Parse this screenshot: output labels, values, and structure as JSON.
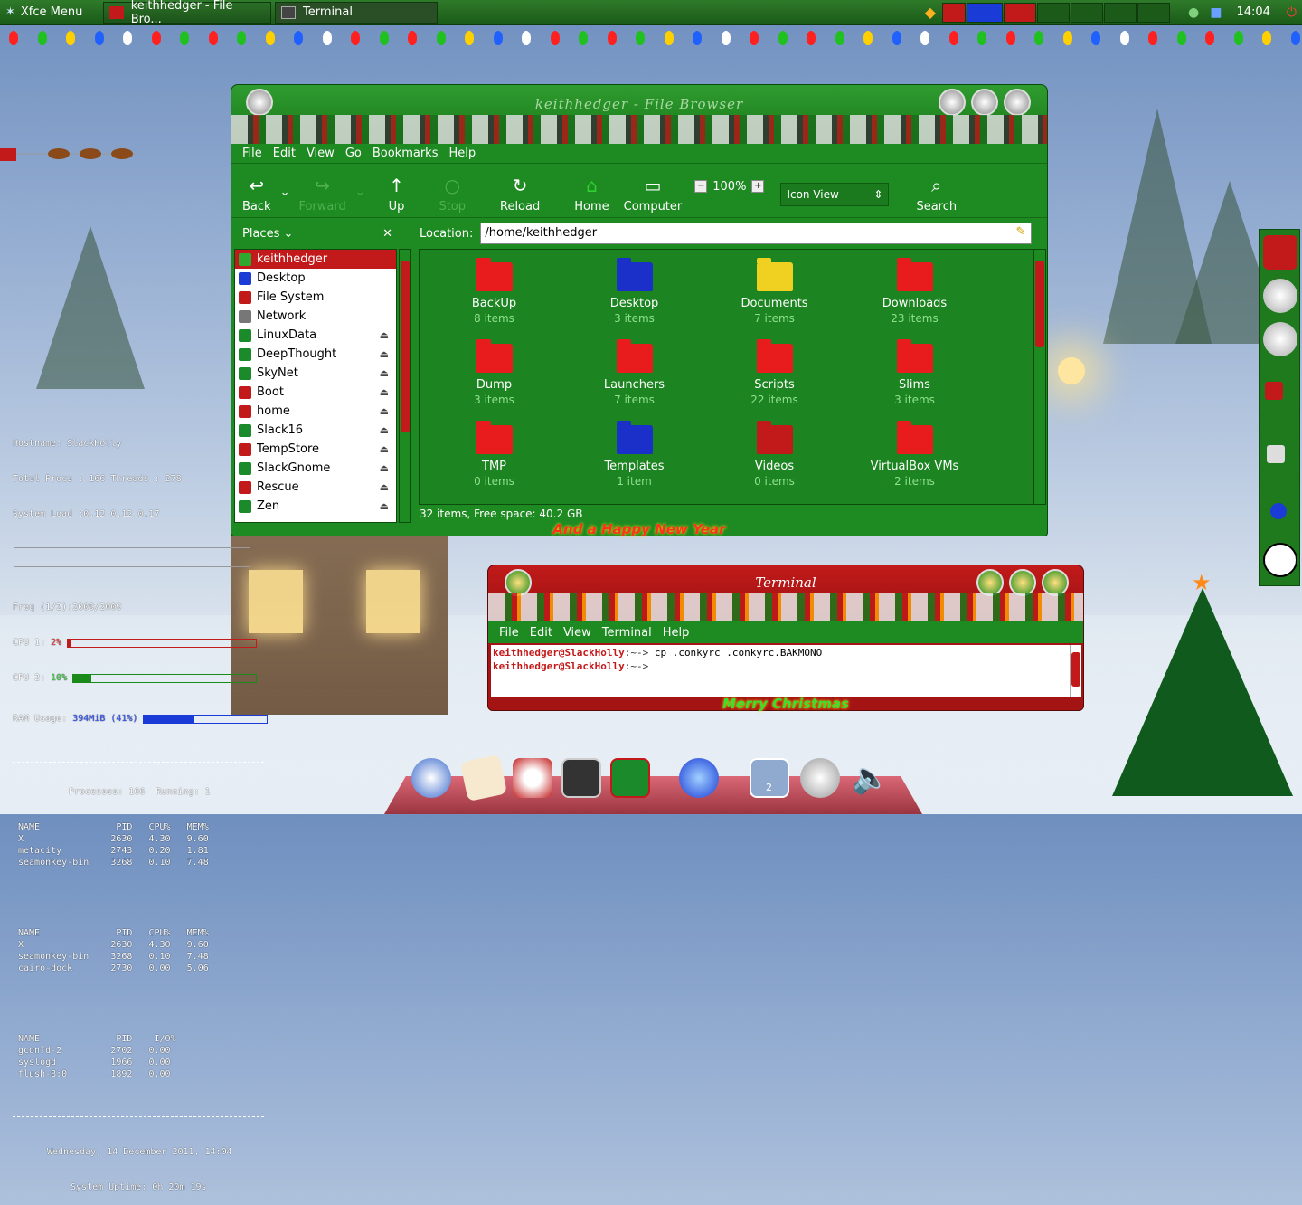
{
  "panel": {
    "menu_label": "Xfce Menu",
    "tasks": [
      {
        "label": "keithhedger - File Bro..."
      },
      {
        "label": "Terminal"
      }
    ],
    "clock": "14:04"
  },
  "conky": {
    "hostname": "Hostname: SlackHolly",
    "procs": "Total Procs : 166 Threads : 278",
    "load": "System Load :0.12 0.12 0.17",
    "freq": "Freq (1/2):2009/2009",
    "cpu1_label": "CPU 1:",
    "cpu1_val": "2%",
    "cpu2_label": "CPU 2:",
    "cpu2_val": "10%",
    "ram_label": "RAM Usage:",
    "ram_val": "394MiB (41%)",
    "cpu1_fraction": 0.02,
    "cpu2_fraction": 0.1,
    "ram_fraction": 0.41,
    "processes_header": "Processes: 166  Running: 1",
    "table1": "NAME              PID   CPU%   MEM%\nX                2630   4.30   9.60\nmetacity         2743   0.20   1.81\nseamonkey-bin    3268   0.10   7.48",
    "table2": "NAME              PID   CPU%   MEM%\nX                2630   4.30   9.60\nseamonkey-bin    3268   0.10   7.48\ncairo-dock       2730   0.00   5.06",
    "table3": "NAME              PID    I/O%\ngconfd-2         2702   0.00\nsyslogd          1966   0.00\nflush-8:0        1892   0.00",
    "date": "Wednesday, 14 December 2011, 14:04",
    "uptime": "System Uptime: 0h 20m 19s"
  },
  "file_browser": {
    "title": "keithhedger - File Browser",
    "menu": [
      "File",
      "Edit",
      "View",
      "Go",
      "Bookmarks",
      "Help"
    ],
    "toolbar": {
      "back": "Back",
      "forward": "Forward",
      "up": "Up",
      "stop": "Stop",
      "reload": "Reload",
      "home": "Home",
      "computer": "Computer",
      "zoom": "100%",
      "view_mode": "Icon View",
      "search": "Search"
    },
    "places_label": "Places",
    "location_label": "Location:",
    "location_value": "/home/keithhedger",
    "places": [
      {
        "label": "keithhedger",
        "color": "#2fa82f",
        "eject": false,
        "selected": true
      },
      {
        "label": "Desktop",
        "color": "#1a3bd6",
        "eject": false
      },
      {
        "label": "File System",
        "color": "#c21a1a",
        "eject": false
      },
      {
        "label": "Network",
        "color": "#777777",
        "eject": false
      },
      {
        "label": "LinuxData",
        "color": "#1a8a2a",
        "eject": true
      },
      {
        "label": "DeepThought",
        "color": "#1a8a2a",
        "eject": true
      },
      {
        "label": "SkyNet",
        "color": "#1a8a2a",
        "eject": true
      },
      {
        "label": "Boot",
        "color": "#c21a1a",
        "eject": true
      },
      {
        "label": "home",
        "color": "#c21a1a",
        "eject": true
      },
      {
        "label": "Slack16",
        "color": "#1a8a2a",
        "eject": true
      },
      {
        "label": "TempStore",
        "color": "#c21a1a",
        "eject": true
      },
      {
        "label": "SlackGnome",
        "color": "#1a8a2a",
        "eject": true
      },
      {
        "label": "Rescue",
        "color": "#c21a1a",
        "eject": true
      },
      {
        "label": "Zen",
        "color": "#1a8a2a",
        "eject": true
      }
    ],
    "folders": [
      {
        "name": "BackUp",
        "count": "8 items",
        "color": "#e81c1c"
      },
      {
        "name": "Desktop",
        "count": "3 items",
        "color": "#1a30c8"
      },
      {
        "name": "Documents",
        "count": "7 items",
        "color": "#f0d020"
      },
      {
        "name": "Downloads",
        "count": "23 items",
        "color": "#e81c1c"
      },
      {
        "name": "Dump",
        "count": "3 items",
        "color": "#e81c1c"
      },
      {
        "name": "Launchers",
        "count": "7 items",
        "color": "#e81c1c"
      },
      {
        "name": "Scripts",
        "count": "22 items",
        "color": "#e81c1c"
      },
      {
        "name": "Slims",
        "count": "3 items",
        "color": "#e81c1c"
      },
      {
        "name": "TMP",
        "count": "0 items",
        "color": "#e81c1c"
      },
      {
        "name": "Templates",
        "count": "1 item",
        "color": "#1a30c8"
      },
      {
        "name": "Videos",
        "count": "0 items",
        "color": "#c21a1a"
      },
      {
        "name": "VirtualBox VMs",
        "count": "2 items",
        "color": "#e81c1c"
      }
    ],
    "status": "32 items, Free space: 40.2 GB",
    "footer": "And a Happy New Year"
  },
  "terminal": {
    "title": "Terminal",
    "menu": [
      "File",
      "Edit",
      "View",
      "Terminal",
      "Help"
    ],
    "lines": [
      {
        "prompt": "keithhedger@SlackHolly",
        "path": ":~->",
        "cmd": " cp .conkyrc .conkyrc.BAKMONO"
      },
      {
        "prompt": "keithhedger@SlackHolly",
        "path": ":~->",
        "cmd": ""
      }
    ],
    "footer": "Merry Christmas"
  },
  "dock": {
    "badge": "2"
  },
  "colors": {
    "accent_green": "#1e8a22",
    "accent_red": "#c21a1a"
  }
}
